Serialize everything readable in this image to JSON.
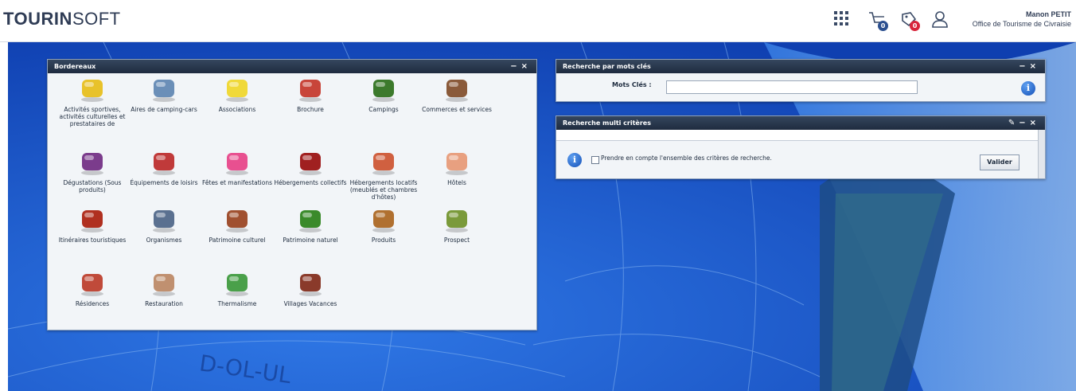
{
  "header": {
    "logo_bold": "TOURIN",
    "logo_light": "SOFT",
    "cart_badge": "0",
    "notif_badge": "0",
    "user_name": "Manon PETIT",
    "user_org": "Office de Tourisme de Civraisie"
  },
  "colors": {
    "accent_dark": "#2f3c55",
    "panel_header": "#1f2c3f",
    "badge_blue": "#2b4f8f",
    "badge_red": "#d8243a"
  },
  "bordereaux": {
    "title": "Bordereaux",
    "items": [
      {
        "label": "Activités sportives, activités culturelles et prestataires de",
        "icon": "ball-icon"
      },
      {
        "label": "Aires de camping-cars",
        "icon": "camper-van-icon"
      },
      {
        "label": "Associations",
        "icon": "notes-icon"
      },
      {
        "label": "Brochure",
        "icon": "brochure-icon"
      },
      {
        "label": "Campings",
        "icon": "tent-icon"
      },
      {
        "label": "Commerces et services",
        "icon": "shopkeeper-icon"
      },
      {
        "label": "Dégustations (Sous produits)",
        "icon": "jar-icon"
      },
      {
        "label": "Équipements de loisirs",
        "icon": "bowling-icon"
      },
      {
        "label": "Fêtes et manifestations",
        "icon": "balloons-icon"
      },
      {
        "label": "Hébergements collectifs",
        "icon": "bunk-bed-icon"
      },
      {
        "label": "Hébergements locatifs (meublés et chambres d'hôtes)",
        "icon": "key-icon"
      },
      {
        "label": "Hôtels",
        "icon": "hotel-icon"
      },
      {
        "label": "Itinéraires touristiques",
        "icon": "signpost-icon"
      },
      {
        "label": "Organismes",
        "icon": "ballot-box-icon"
      },
      {
        "label": "Patrimoine culturel",
        "icon": "painting-icon"
      },
      {
        "label": "Patrimoine naturel",
        "icon": "tree-icon"
      },
      {
        "label": "Produits",
        "icon": "box-icon"
      },
      {
        "label": "Prospect",
        "icon": "people-icon"
      },
      {
        "label": "Résidences",
        "icon": "residence-icon"
      },
      {
        "label": "Restauration",
        "icon": "menu-icon"
      },
      {
        "label": "Thermalisme",
        "icon": "watering-can-icon"
      },
      {
        "label": "Villages Vacances",
        "icon": "village-icon"
      }
    ]
  },
  "meta": {
    "title": "Recherche par mots clés",
    "field_label": "Mots Clés :",
    "field_value": ""
  },
  "multi": {
    "title": "Recherche multi critères",
    "checkbox_label": "Prendre en compte l'ensemble des critères de recherche.",
    "valider": "Valider"
  },
  "background_text": "D-OL-UL"
}
